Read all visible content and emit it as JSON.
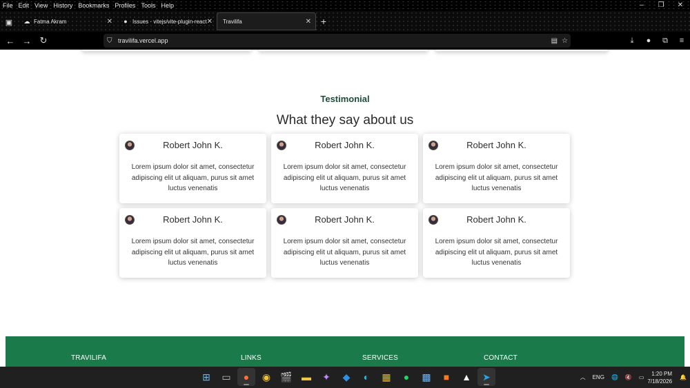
{
  "menubar": {
    "items": [
      "File",
      "Edit",
      "View",
      "History",
      "Bookmarks",
      "Profiles",
      "Tools",
      "Help"
    ]
  },
  "tabs": [
    {
      "title": "Fatma Akram",
      "icon": "user-icon",
      "active": false
    },
    {
      "title": "Issues · vitejs/vite-plugin-react",
      "icon": "github-icon",
      "active": false
    },
    {
      "title": "Travilifa",
      "icon": "",
      "active": true
    }
  ],
  "address_bar": {
    "url": "travilifa.vercel.app"
  },
  "testimonials": {
    "label": "Testimonial",
    "title": "What they say about us",
    "cards": [
      {
        "name": "Robert John K.",
        "quote": "Lorem ipsum dolor sit amet, consectetur adipiscing elit ut aliquam, purus sit amet luctus venenatis"
      },
      {
        "name": "Robert John K.",
        "quote": "Lorem ipsum dolor sit amet, consectetur adipiscing elit ut aliquam, purus sit amet luctus venenatis"
      },
      {
        "name": "Robert John K.",
        "quote": "Lorem ipsum dolor sit amet, consectetur adipiscing elit ut aliquam, purus sit amet luctus venenatis"
      },
      {
        "name": "Robert John K.",
        "quote": "Lorem ipsum dolor sit amet, consectetur adipiscing elit ut aliquam, purus sit amet luctus venenatis"
      },
      {
        "name": "Robert John K.",
        "quote": "Lorem ipsum dolor sit amet, consectetur adipiscing elit ut aliquam, purus sit amet luctus venenatis"
      },
      {
        "name": "Robert John K.",
        "quote": "Lorem ipsum dolor sit amet, consectetur adipiscing elit ut aliquam, purus sit amet luctus venenatis"
      }
    ]
  },
  "footer": {
    "brand": "TRAVILIFA",
    "links_heading": "LINKS",
    "services_heading": "SERVICES",
    "contact_heading": "CONTACT",
    "background_color": "#1a7a4a"
  },
  "taskbar": {
    "language": "ENG",
    "time": "1:20 PM",
    "date": "7/18/2026",
    "apps": [
      "windows-start-icon",
      "file-manager-icon",
      "firefox-icon",
      "chrome-icon",
      "clapper-icon",
      "folder-icon",
      "copilot-icon",
      "vscode-icon",
      "edge-icon",
      "tools-icon",
      "whatsapp-icon",
      "photos-icon",
      "xampp-icon",
      "notion-icon",
      "telegram-icon"
    ]
  },
  "colors": {
    "accent_green": "#1a7a4a",
    "label_dark_green": "#1e4d3a"
  }
}
